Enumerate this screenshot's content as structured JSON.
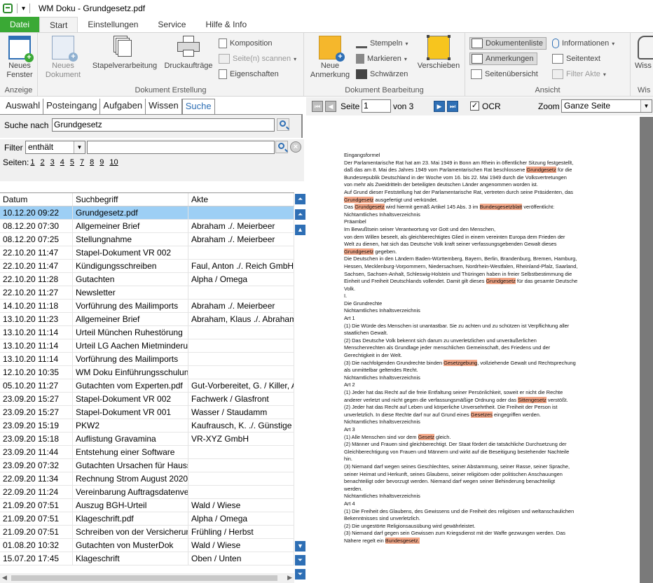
{
  "window": {
    "title": "WM Doku - Grundgesetz.pdf"
  },
  "ribbon_tabs": [
    "Datei",
    "Start",
    "Einstellungen",
    "Service",
    "Hilfe & Info"
  ],
  "ribbon": {
    "anzeige": {
      "label": "Anzeige",
      "neues_fenster": "Neues\nFenster"
    },
    "erstellung": {
      "label": "Dokument Erstellung",
      "neues_dokument": "Neues\nDokument",
      "stapelverarbeitung": "Stapelverarbeitung",
      "druckauftraege": "Druckaufträge",
      "komposition": "Komposition",
      "scannen": "Seite(n) scannen",
      "eigenschaften": "Eigenschaften"
    },
    "bearbeitung": {
      "label": "Dokument Bearbeitung",
      "neue_anmerkung": "Neue\nAnmerkung",
      "stempeln": "Stempeln",
      "markieren": "Markieren",
      "schwaerzen": "Schwärzen",
      "verschieben": "Verschieben"
    },
    "ansicht": {
      "label": "Ansicht",
      "dokumentenliste": "Dokumentenliste",
      "anmerkungen": "Anmerkungen",
      "seitenuebersicht": "Seitenübersicht",
      "informationen": "Informationen",
      "seitentext": "Seitentext",
      "filter_akte": "Filter Akte"
    },
    "wissen": {
      "label": "Wis",
      "btn": "Wiss"
    }
  },
  "nav_tabs": [
    "Auswahl",
    "Posteingang",
    "Aufgaben",
    "Wissen",
    "Suche"
  ],
  "search": {
    "label": "Suche nach",
    "value": "Grundgesetz",
    "filter_label": "Filter",
    "filter_mode": "enthält",
    "filter_value": "",
    "pages_label": "Seiten:",
    "pages": [
      "1",
      "2",
      "3",
      "4",
      "5",
      "7",
      "8",
      "9",
      "10"
    ]
  },
  "table": {
    "headers": [
      "Datum",
      "Suchbegriff",
      "Akte"
    ],
    "rows": [
      [
        "10.12.20 09:22",
        "Grundgesetz.pdf",
        ""
      ],
      [
        "08.12.20 07:30",
        "Allgemeiner Brief",
        "Abraham ./. Meierbeer"
      ],
      [
        "08.12.20 07:25",
        "Stellungnahme",
        "Abraham ./. Meierbeer"
      ],
      [
        "22.10.20 11:47",
        "Stapel-Dokument VR 002",
        ""
      ],
      [
        "22.10.20 11:47",
        "Kündigungsschreiben",
        "Faul, Anton ./. Reich GmbH"
      ],
      [
        "22.10.20 11:28",
        "Gutachten",
        "Alpha / Omega"
      ],
      [
        "22.10.20 11:27",
        "Newsletter",
        ""
      ],
      [
        "14.10.20 11:18",
        "Vorführung des Mailimports",
        "Abraham ./. Meierbeer"
      ],
      [
        "13.10.20 11:23",
        "Allgemeiner Brief",
        "Abraham, Klaus ./. Abraham-D"
      ],
      [
        "13.10.20 11:14",
        "Urteil München Ruhestörung",
        ""
      ],
      [
        "13.10.20 11:14",
        "Urteil LG Aachen Mietminderung",
        ""
      ],
      [
        "13.10.20 11:14",
        "Vorführung des Mailimports",
        ""
      ],
      [
        "12.10.20 10:35",
        "WM Doku Einführungsschulung.pd",
        ""
      ],
      [
        "05.10.20 11:27",
        "Gutachten vom Experten.pdf",
        "Gut-Vorbereitet, G. / Killer, Anj"
      ],
      [
        "23.09.20 15:27",
        "Stapel-Dokument VR 002",
        "Fachwerk / Glasfront"
      ],
      [
        "23.09.20 15:27",
        "Stapel-Dokument VR 001",
        "Wasser / Staudamm"
      ],
      [
        "23.09.20 15:19",
        "PKW2",
        "Kaufrausch, K. ./. Günstige Ha"
      ],
      [
        "23.09.20 15:18",
        "Auflistung Gravamina",
        "VR-XYZ GmbH"
      ],
      [
        "23.09.20 11:44",
        "Entstehung einer Software",
        ""
      ],
      [
        "23.09.20 07:32",
        "Gutachten Ursachen für Hausschi",
        ""
      ],
      [
        "22.09.20 11:34",
        "Rechnung Strom August 2020",
        ""
      ],
      [
        "22.09.20 11:24",
        "Vereinbarung Auftragsdatenverei",
        ""
      ],
      [
        "21.09.20 07:51",
        "Auszug BGH-Urteil",
        "Wald / Wiese"
      ],
      [
        "21.09.20 07:51",
        "Klageschrift.pdf",
        "Alpha / Omega"
      ],
      [
        "21.09.20 07:51",
        "Schreiben von der Versicherung",
        "Frühling / Herbst"
      ],
      [
        "01.08.20 10:32",
        "Gutachten von MusterDok",
        "Wald / Wiese"
      ],
      [
        "15.07.20 17:45",
        "Klageschrift",
        "Oben / Unten"
      ]
    ]
  },
  "viewer": {
    "page_label": "Seite",
    "page_value": "1",
    "of_label": "von 3",
    "ocr_label": "OCR",
    "zoom_label": "Zoom",
    "zoom_value": "Ganze Seite"
  },
  "document_lines": [
    [
      [
        "Eingangsformel",
        false
      ]
    ],
    [
      [
        "Der Parlamentarische Rat hat am 23. Mai 1949 in Bonn am Rhein in öffentlicher Sitzung festgestellt,",
        false
      ]
    ],
    [
      [
        "daß das am 8. Mai des Jahres 1949 vom Parlamentarischen Rat beschlossene ",
        false
      ],
      [
        "Grundgesetz",
        true
      ],
      [
        " für die",
        false
      ]
    ],
    [
      [
        "Bundesrepublik Deutschland in der Woche vom 16. bis 22. Mai 1949 durch die Volksvertretungen",
        false
      ]
    ],
    [
      [
        "von mehr als Zweidritteln der beteiligten deutschen Länder angenommen worden ist.",
        false
      ]
    ],
    [
      [
        "Auf Grund dieser Feststellung hat der Parlamentarische Rat, vertreten durch seine Präsidenten, das",
        false
      ]
    ],
    [
      [
        "Grundgesetz",
        true
      ],
      [
        " ausgefertigt und verkündet.",
        false
      ]
    ],
    [
      [
        "Das ",
        false
      ],
      [
        "Grundgesetz",
        true
      ],
      [
        " wird hiermit gemäß Artikel 145 Abs. 3 im ",
        false
      ],
      [
        "Bundesgesetzblatt",
        true
      ],
      [
        " veröffentlicht:",
        false
      ]
    ],
    [
      [
        "Nichtamtliches Inhaltsverzeichnis",
        false
      ]
    ],
    [
      [
        "Präambel",
        false
      ]
    ],
    [
      [
        "Im Bewußtsein seiner Verantwortung vor Gott und den Menschen,",
        false
      ]
    ],
    [
      [
        "von dem Willen beseelt, als gleichberechtigtes Glied in einem vereinten Europa dem Frieden der",
        false
      ]
    ],
    [
      [
        "Welt zu dienen, hat sich das Deutsche Volk kraft seiner verfassungsgebenden Gewalt dieses",
        false
      ]
    ],
    [
      [
        "Grundgesetz",
        true
      ],
      [
        " gegeben.",
        false
      ]
    ],
    [
      [
        "Die Deutschen in den Ländern Baden-Württemberg, Bayern, Berlin, Brandenburg, Bremen, Hamburg,",
        false
      ]
    ],
    [
      [
        "Hessen, Mecklenburg-Vorpommern, Niedersachsen, Nordrhein-Westfalen, Rheinland-Pfalz, Saarland,",
        false
      ]
    ],
    [
      [
        "Sachsen, Sachsen-Anhalt, Schleswig-Holstein und Thüringen haben in freier Selbstbestimmung die",
        false
      ]
    ],
    [
      [
        "Einheit und Freiheit Deutschlands vollendet. Damit gilt dieses ",
        false
      ],
      [
        "Grundgesetz",
        true
      ],
      [
        " für das gesamte Deutsche",
        false
      ]
    ],
    [
      [
        "Volk.",
        false
      ]
    ],
    [
      [
        "I.",
        false
      ]
    ],
    [
      [
        "Die Grundrechte",
        false
      ]
    ],
    [
      [
        "Nichtamtliches Inhaltsverzeichnis",
        false
      ]
    ],
    [
      [
        "Art 1",
        false
      ]
    ],
    [
      [
        "(1) Die Würde des Menschen ist unantastbar. Sie zu achten und zu schützen ist Verpflichtung aller",
        false
      ]
    ],
    [
      [
        "staatlichen Gewalt.",
        false
      ]
    ],
    [
      [
        "(2) Das Deutsche Volk bekennt sich darum zu unverletzlichen und unveräußerlichen",
        false
      ]
    ],
    [
      [
        "Menschenrechten als Grundlage jeder menschlichen Gemeinschaft, des Friedens und der",
        false
      ]
    ],
    [
      [
        "Gerechtigkeit in der Welt.",
        false
      ]
    ],
    [
      [
        "(3) Die nachfolgenden Grundrechte binden ",
        false
      ],
      [
        "Gesetzgebung",
        true
      ],
      [
        ", vollziehende Gewalt und Rechtsprechung",
        false
      ]
    ],
    [
      [
        "als unmittelbar geltendes Recht.",
        false
      ]
    ],
    [
      [
        "Nichtamtliches Inhaltsverzeichnis",
        false
      ]
    ],
    [
      [
        "Art 2",
        false
      ]
    ],
    [
      [
        "(1) Jeder hat das Recht auf die freie Entfaltung seiner Persönlichkeit, soweit er nicht die Rechte",
        false
      ]
    ],
    [
      [
        "anderer verletzt und nicht gegen die verfassungsmäßige Ordnung oder das ",
        false
      ],
      [
        "Sittengesetz",
        true
      ],
      [
        " verstößt.",
        false
      ]
    ],
    [
      [
        "(2) Jeder hat das Recht auf Leben und körperliche Unversehrtheit. Die Freiheit der Person ist",
        false
      ]
    ],
    [
      [
        "unverletzlich. In diese Rechte darf nur auf Grund eines ",
        false
      ],
      [
        "Gesetzes",
        true
      ],
      [
        " eingegriffen werden.",
        false
      ]
    ],
    [
      [
        "Nichtamtliches Inhaltsverzeichnis",
        false
      ]
    ],
    [
      [
        "Art 3",
        false
      ]
    ],
    [
      [
        "(1) Alle Menschen sind vor dem ",
        false
      ],
      [
        "Gesetz",
        true
      ],
      [
        " gleich.",
        false
      ]
    ],
    [
      [
        "(2) Männer und Frauen sind gleichberechtigt. Der Staat fördert die tatsächliche Durchsetzung der",
        false
      ]
    ],
    [
      [
        "Gleichberechtigung von Frauen und Männern und wirkt auf die Beseitigung bestehender Nachteile",
        false
      ]
    ],
    [
      [
        "hin.",
        false
      ]
    ],
    [
      [
        "(3) Niemand darf wegen seines Geschlechtes, seiner Abstammung, seiner Rasse, seiner Sprache,",
        false
      ]
    ],
    [
      [
        "seiner Heimat und Herkunft, seines Glaubens, seiner religiösen oder politischen Anschauungen",
        false
      ]
    ],
    [
      [
        "benachteiligt oder bevorzugt werden. Niemand darf wegen seiner Behinderung benachteiligt",
        false
      ]
    ],
    [
      [
        "werden.",
        false
      ]
    ],
    [
      [
        "Nichtamtliches Inhaltsverzeichnis",
        false
      ]
    ],
    [
      [
        "Art 4",
        false
      ]
    ],
    [
      [
        "(1) Die Freiheit des Glaubens, des Gewissens und die Freiheit des religiösen und weltanschaulichen",
        false
      ]
    ],
    [
      [
        "Bekenntnisses sind unverletzlich.",
        false
      ]
    ],
    [
      [
        "(2) Die ungestörte Religionsausübung wird gewährleistet.",
        false
      ]
    ],
    [
      [
        "(3) Niemand darf gegen sein Gewissen zum Kriegsdienst mit der Waffe gezwungen werden. Das",
        false
      ]
    ],
    [
      [
        "Nähere regelt ein ",
        false
      ],
      [
        "Bundesgesetz.",
        true
      ]
    ]
  ]
}
